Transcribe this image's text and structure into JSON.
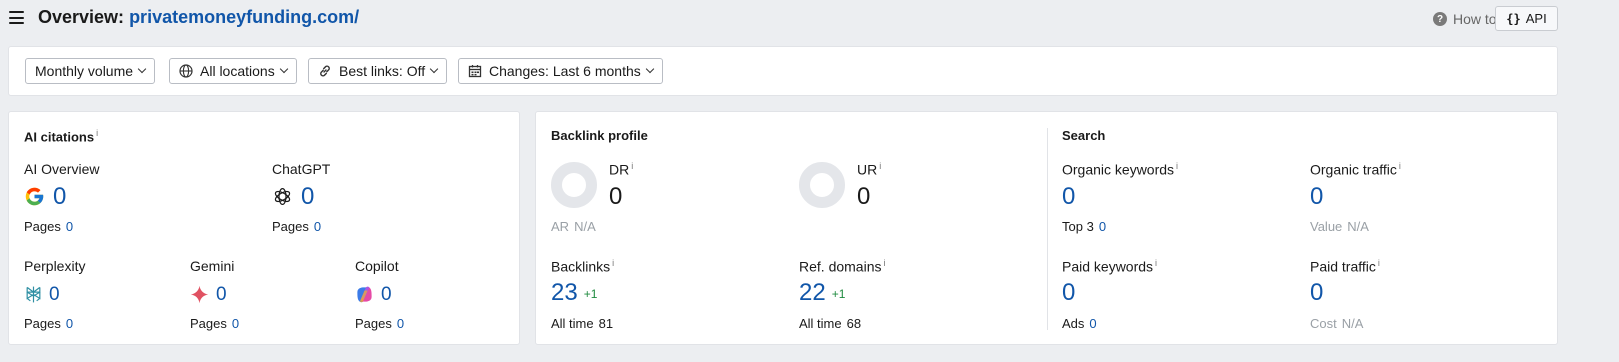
{
  "header": {
    "title_prefix": "Overview:",
    "domain": "privatemoneyfunding.com/",
    "how_to_use": "How to use",
    "api_label": "API",
    "api_braces": "{}"
  },
  "filters": [
    {
      "label": "Monthly volume",
      "icon": "none"
    },
    {
      "label": "All locations",
      "icon": "globe-icon"
    },
    {
      "label": "Best links: Off",
      "icon": "link-icon"
    },
    {
      "label": "Changes: Last 6 months",
      "icon": "calendar-icon"
    }
  ],
  "ai_citations": {
    "title": "AI citations",
    "info": "i",
    "items": {
      "ai_overview": {
        "label": "AI Overview",
        "value": "0",
        "sub_label": "Pages",
        "sub_value": "0",
        "icon": "google-icon"
      },
      "chatgpt": {
        "label": "ChatGPT",
        "value": "0",
        "sub_label": "Pages",
        "sub_value": "0",
        "icon": "chatgpt-icon"
      },
      "perplexity": {
        "label": "Perplexity",
        "value": "0",
        "sub_label": "Pages",
        "sub_value": "0",
        "icon": "perplexity-icon"
      },
      "gemini": {
        "label": "Gemini",
        "value": "0",
        "sub_label": "Pages",
        "sub_value": "0",
        "icon": "gemini-icon"
      },
      "copilot": {
        "label": "Copilot",
        "value": "0",
        "sub_label": "Pages",
        "sub_value": "0",
        "icon": "copilot-icon"
      }
    }
  },
  "backlink_profile": {
    "title": "Backlink profile",
    "dr": {
      "label": "DR",
      "info": "i",
      "value": "0",
      "sub_label": "AR",
      "sub_value": "N/A"
    },
    "ur": {
      "label": "UR",
      "info": "i",
      "value": "0"
    },
    "backlinks": {
      "label": "Backlinks",
      "info": "i",
      "value": "23",
      "delta": "+1",
      "sub_label": "All time",
      "sub_value": "81"
    },
    "ref_domains": {
      "label": "Ref. domains",
      "info": "i",
      "value": "22",
      "delta": "+1",
      "sub_label": "All time",
      "sub_value": "68"
    }
  },
  "search": {
    "title": "Search",
    "organic_keywords": {
      "label": "Organic keywords",
      "info": "i",
      "value": "0",
      "sub_label": "Top 3",
      "sub_value": "0"
    },
    "organic_traffic": {
      "label": "Organic traffic",
      "info": "i",
      "value": "0",
      "sub_label": "Value",
      "sub_value": "N/A"
    },
    "paid_keywords": {
      "label": "Paid keywords",
      "info": "i",
      "value": "0",
      "sub_label": "Ads",
      "sub_value": "0"
    },
    "paid_traffic": {
      "label": "Paid traffic",
      "info": "i",
      "value": "0",
      "sub_label": "Cost",
      "sub_value": "N/A"
    }
  },
  "colors": {
    "link_blue": "#1156a9",
    "delta_green": "#1e8a3e",
    "muted": "#9aa0a6",
    "page_bg": "#eceef1"
  }
}
